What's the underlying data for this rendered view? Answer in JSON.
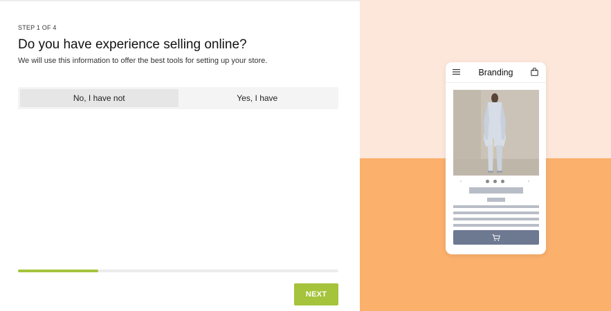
{
  "wizard": {
    "step_label": "STEP 1 OF 4",
    "question": "Do you have experience selling online?",
    "description": "We will use this information to offer the best tools for setting up your store.",
    "options": [
      {
        "label": "No, I have not",
        "selected": true
      },
      {
        "label": "Yes, I have",
        "selected": false
      }
    ],
    "progress_fraction": 0.25,
    "next_label": "NEXT"
  },
  "preview": {
    "title": "Branding",
    "menu_icon": "hamburger-icon",
    "bag_icon": "shopping-bag-icon",
    "cart_icon": "cart-icon",
    "carousel_prev": "‹",
    "carousel_next": "›"
  },
  "colors": {
    "accent": "#a5c33b",
    "preview_bg_top": "#fde7da",
    "preview_bg_bottom": "#fbb06c",
    "cart_button": "#6d7891"
  }
}
